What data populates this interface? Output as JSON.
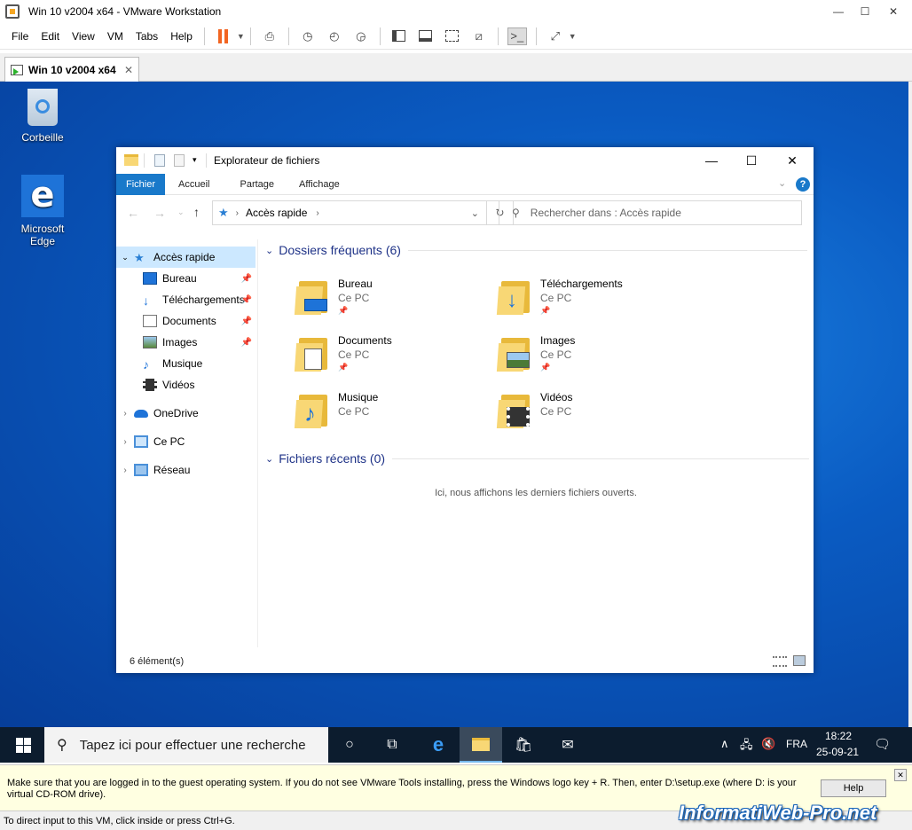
{
  "vmware": {
    "title": "Win 10 v2004 x64 - VMware Workstation",
    "menu": [
      "File",
      "Edit",
      "View",
      "VM",
      "Tabs",
      "Help"
    ],
    "tab_label": "Win 10 v2004 x64"
  },
  "desktop": {
    "icons": [
      {
        "label": "Corbeille",
        "icon": "recycle-bin-icon"
      },
      {
        "label": "Microsoft Edge",
        "icon": "edge-icon"
      }
    ]
  },
  "explorer": {
    "title": "Explorateur de fichiers",
    "ribbon_tabs": [
      "Fichier",
      "Accueil",
      "Partage",
      "Affichage"
    ],
    "address": "Accès rapide",
    "search_placeholder": "Rechercher dans : Accès rapide",
    "nav": {
      "quick_access": "Accès rapide",
      "items": [
        {
          "label": "Bureau",
          "pinned": true
        },
        {
          "label": "Téléchargements",
          "pinned": true
        },
        {
          "label": "Documents",
          "pinned": true
        },
        {
          "label": "Images",
          "pinned": true
        },
        {
          "label": "Musique",
          "pinned": false
        },
        {
          "label": "Vidéos",
          "pinned": false
        }
      ],
      "onedrive": "OneDrive",
      "this_pc": "Ce PC",
      "network": "Réseau"
    },
    "frequent_header": "Dossiers fréquents (6)",
    "folders": [
      {
        "name": "Bureau",
        "location": "Ce PC",
        "pinned": true
      },
      {
        "name": "Téléchargements",
        "location": "Ce PC",
        "pinned": true
      },
      {
        "name": "Documents",
        "location": "Ce PC",
        "pinned": true
      },
      {
        "name": "Images",
        "location": "Ce PC",
        "pinned": true
      },
      {
        "name": "Musique",
        "location": "Ce PC",
        "pinned": false
      },
      {
        "name": "Vidéos",
        "location": "Ce PC",
        "pinned": false
      }
    ],
    "recent_header": "Fichiers récents (0)",
    "recent_empty": "Ici, nous affichons les derniers fichiers ouverts.",
    "status": "6 élément(s)"
  },
  "taskbar": {
    "search_placeholder": "Tapez ici pour effectuer une recherche",
    "lang": "FRA",
    "time": "18:22",
    "date": "25-09-21"
  },
  "infobar": {
    "message": "Make sure that you are logged in to the guest operating system. If you do not see VMware Tools installing, press the Windows logo key + R. Then, enter D:\\setup.exe (where D: is your virtual CD-ROM drive).",
    "help_label": "Help"
  },
  "statusbar": "To direct input to this VM, click inside or press Ctrl+G.",
  "watermark": "InformatiWeb-Pro.net"
}
